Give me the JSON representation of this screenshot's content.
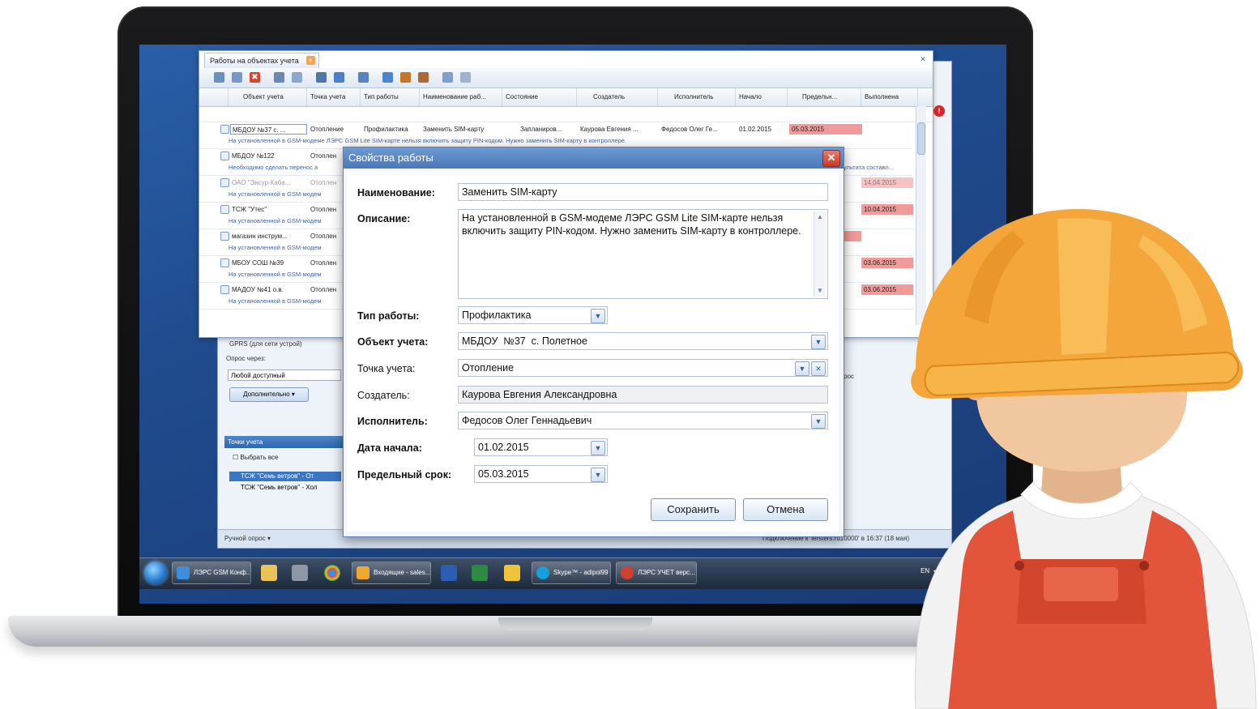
{
  "table_window": {
    "tab_title": "Работы на объектах учета",
    "columns": [
      "Объект учета",
      "Точка учета",
      "Тип работы",
      "Наименование раб...",
      "Состояние",
      "Создатель",
      "Исполнитель",
      "Начало",
      "Предельн...",
      "Выполнена"
    ],
    "rows": [
      {
        "object": "МБДОУ №37 с. ...",
        "point": "Отопление",
        "type": "Профилактика",
        "name": "Заменить SIM-карту",
        "state": "Запланиров...",
        "creator": "Каурова Евгения ...",
        "executor": "Федосов Олег Ге...",
        "start": "01.02.2015",
        "deadline": "05.03.2015",
        "desc": "На установленной в GSM-модеме ЛЭРС GSM Lite SIM-карте нельзя включить защиту PIN-кодом. Нужно заменить SIM-карту в контроллере."
      },
      {
        "object": "МБДОУ №122",
        "point": "Отоплен",
        "type": "",
        "name": "",
        "state": "",
        "creator": "",
        "executor": "",
        "start": "",
        "deadline": "",
        "desc": "Необходимо сделать перенос а"
      },
      {
        "object": "ОАО \"Энсур-Каба...",
        "point": "Отоплен",
        "type": "",
        "name": "",
        "state": "",
        "creator": "",
        "executor": "",
        "start": "",
        "deadline": "14.04.2015",
        "desc": "На установленной в GSM-модем"
      },
      {
        "object": "ТСЖ \"Утес\"",
        "point": "Отоплен",
        "type": "",
        "name": "",
        "state": "",
        "creator": "",
        "executor": "",
        "start": "",
        "deadline": "10.04.2015",
        "desc": "На установленной в GSM-модем"
      },
      {
        "object": "магазин инструм...",
        "point": "Отоплен",
        "type": "",
        "name": "",
        "state": "",
        "creator": "",
        "executor": "",
        "start": "",
        "deadline": "",
        "desc": "На установленной в GSM-модем"
      },
      {
        "object": "МБОУ СОШ №39",
        "point": "Отоплен",
        "type": "",
        "name": "",
        "state": "",
        "creator": "",
        "executor": "",
        "start": "",
        "deadline": "03.06.2015",
        "desc": "На установленной в GSM-модем"
      },
      {
        "object": "МАДОУ №41 о.в.",
        "point": "Отоплен",
        "type": "",
        "name": "",
        "state": "",
        "creator": "",
        "executor": "",
        "start": "",
        "deadline": "03.06.2015",
        "desc": "На установленной в GSM-модем"
      }
    ],
    "side_note": "ультата составл..."
  },
  "back_window": {
    "gprs_label": "GPRS (для сети устрой)",
    "poll_label": "Опрос через:",
    "poll_value": "Любой доступный",
    "more_button": "Дополнительно",
    "points_header": "Точки учета",
    "select_all": "Выбрать все",
    "tree_items": [
      "ТСЖ \"Семь ветров\" - От",
      "ТСЖ \"Семь ветров\" - Хол"
    ],
    "status_left": "Ручной опрос ▾",
    "status_right": "Подключение к 'lersters.ru10000' в 16:37 (18 мая)",
    "right_stub": "рос"
  },
  "dialog": {
    "title": "Свойства работы",
    "labels": {
      "name": "Наименование:",
      "description": "Описание:",
      "work_type": "Тип работы:",
      "object": "Объект учета:",
      "point": "Точка учета:",
      "creator": "Создатель:",
      "executor": "Исполнитель:",
      "start_date": "Дата начала:",
      "deadline": "Предельный срок:"
    },
    "values": {
      "name": "Заменить SIM-карту",
      "description": "На установленной в GSM-модеме ЛЭРС GSM Lite SIM-карте нельзя включить защиту PIN-кодом. Нужно заменить SIM-карту в контроллере.",
      "work_type": "Профилактика",
      "object": "МБДОУ  №37  с. Полетное",
      "point": "Отопление",
      "creator": "Каурова Евгения Александровна",
      "executor": "Федосов Олег Геннадьевич",
      "start_date": "01.02.2015",
      "deadline": "05.03.2015"
    },
    "buttons": {
      "save": "Сохранить",
      "cancel": "Отмена"
    }
  },
  "taskbar": {
    "items": [
      "ЛЭРС GSM Конф...",
      "Входящие - sales...",
      "Skype™ - adipol99",
      "ЛЭРС УЧЕТ верс..."
    ],
    "tray_lang": "EN"
  },
  "colors": {
    "accent": "#4a78b9",
    "deadline_red": "#f19a9a",
    "helmet": "#f4a63a",
    "overalls": "#e2553a"
  }
}
